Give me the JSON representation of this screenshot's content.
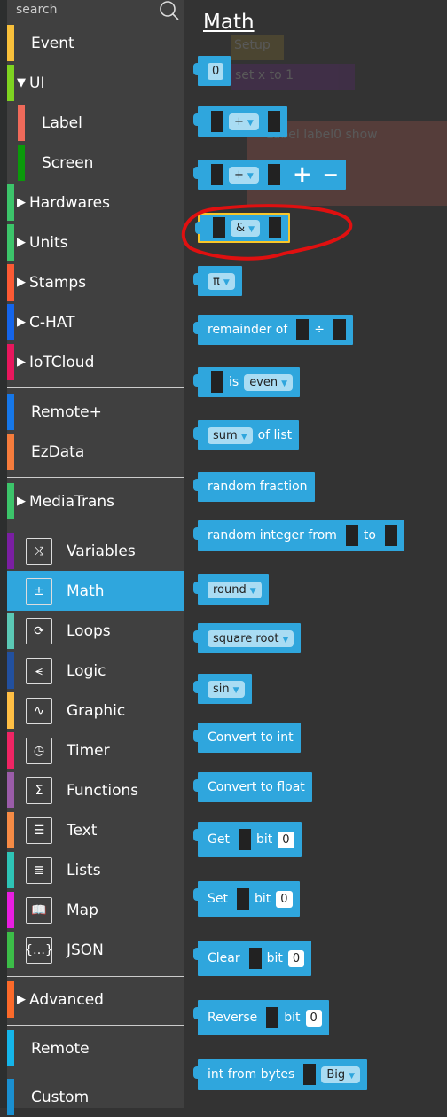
{
  "search": {
    "placeholder": "search"
  },
  "sidebar": {
    "items": [
      {
        "label": "Event",
        "color": "#f8c03b",
        "arrow": ""
      },
      {
        "label": "UI",
        "color": "#7ed321",
        "arrow": "▼"
      },
      {
        "label": "Label",
        "color": "#ef6a5a",
        "arrow": "",
        "sub": true
      },
      {
        "label": "Screen",
        "color": "#0a9a0a",
        "arrow": "",
        "sub": true
      },
      {
        "label": "Hardwares",
        "color": "#3cc46a",
        "arrow": "▶"
      },
      {
        "label": "Units",
        "color": "#3cc46a",
        "arrow": "▶"
      },
      {
        "label": "Stamps",
        "color": "#fb5a34",
        "arrow": "▶"
      },
      {
        "label": "C-HAT",
        "color": "#1565ea",
        "arrow": "▶"
      },
      {
        "label": "IoTCloud",
        "color": "#e8175d",
        "arrow": "▶"
      },
      {
        "label": "Remote+",
        "color": "#1677e8",
        "arrow": ""
      },
      {
        "label": "EzData",
        "color": "#f57c3c",
        "arrow": ""
      },
      {
        "label": "MediaTrans",
        "color": "#3cc46a",
        "arrow": "▶"
      }
    ],
    "categories": [
      {
        "label": "Variables",
        "color": "#7a1fa2",
        "icon": "shuffle-icon"
      },
      {
        "label": "Math",
        "color": "#2fa6dd",
        "icon": "math-operators-icon",
        "selected": true
      },
      {
        "label": "Loops",
        "color": "#5bc8b5",
        "icon": "loop-arrows-icon"
      },
      {
        "label": "Logic",
        "color": "#22509e",
        "icon": "logic-branch-icon"
      },
      {
        "label": "Graphic",
        "color": "#ffbf44",
        "icon": "graph-line-icon"
      },
      {
        "label": "Timer",
        "color": "#ef2564",
        "icon": "stopwatch-icon"
      },
      {
        "label": "Functions",
        "color": "#9a5ca8",
        "icon": "sigma-icon"
      },
      {
        "label": "Text",
        "color": "#f58b45",
        "icon": "text-card-icon"
      },
      {
        "label": "Lists",
        "color": "#2ec4b6",
        "icon": "list-icon"
      },
      {
        "label": "Map",
        "color": "#e81ee0",
        "icon": "book-icon"
      },
      {
        "label": "JSON",
        "color": "#3cbd48",
        "icon": "json-braces-icon"
      }
    ],
    "bottom": [
      {
        "label": "Advanced",
        "color": "#fb6a2a",
        "arrow": "▶"
      },
      {
        "label": "Remote",
        "color": "#15b5ea",
        "arrow": ""
      },
      {
        "label": "Custom",
        "color": "#1a8fd0",
        "arrow": ""
      }
    ]
  },
  "flyout": {
    "title": "Math",
    "blocks": {
      "number": "0",
      "plus": "+",
      "plus2": "+",
      "plus_btn": "+",
      "minus_btn": "−",
      "amp": "&",
      "pi": "π",
      "remainder": "remainder of",
      "div": "÷",
      "is": "is",
      "even": "even",
      "sum": "sum",
      "oflist": "of list",
      "randfrac": "random fraction",
      "randint": "random integer from",
      "to": "to",
      "round": "round",
      "sqrt": "square root",
      "sin": "sin",
      "toint": "Convert to int",
      "tofloat": "Convert to float",
      "get": "Get",
      "set": "Set",
      "clear": "Clear",
      "reverse": "Reverse",
      "bit": "bit",
      "zero": "0",
      "intbytes": "int from bytes",
      "big": "Big"
    }
  },
  "ghost": {
    "setup": "Setup",
    "set": "set",
    "x": "x",
    "to": "to",
    "one": "1",
    "label": "Label",
    "label0": "label0",
    "show": "show"
  },
  "colors": {
    "math": "#2fa6dd",
    "highlight": "#f8c629",
    "annotation": "#e01010"
  }
}
